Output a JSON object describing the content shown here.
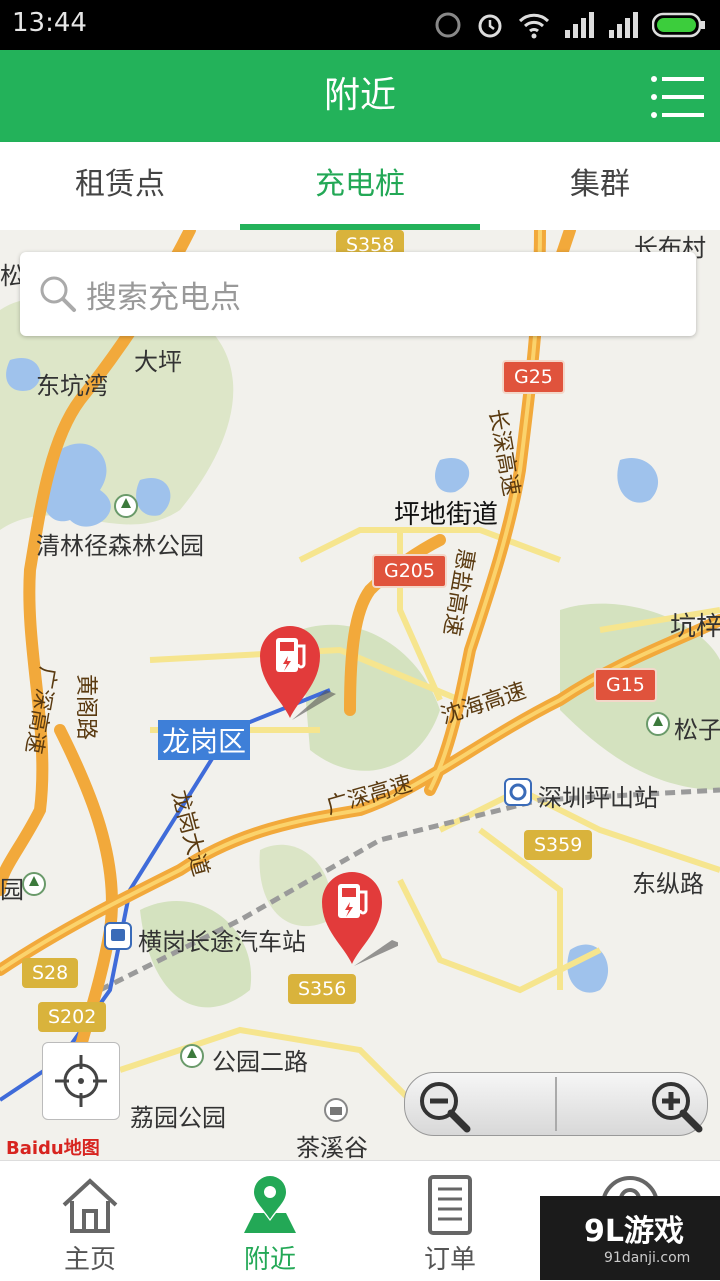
{
  "status_bar": {
    "time": "13:44"
  },
  "header": {
    "title": "附近"
  },
  "tabs": [
    {
      "label": "租赁点",
      "active": false
    },
    {
      "label": "充电桩",
      "active": true
    },
    {
      "label": "集群",
      "active": false
    }
  ],
  "search": {
    "placeholder": "搜索充电点"
  },
  "map": {
    "place_labels": {
      "changbucun": "长布村",
      "song": "松",
      "daping": "大坪",
      "dongkengwan": "东坑湾",
      "qinglinjing": "清林径森林公园",
      "pingdi": "坪地街道",
      "kengzi": "坑梓",
      "songzi": "松子",
      "longgang": "龙岗区",
      "shenzhen_pingshan": "深圳坪山站",
      "dongzonglu": "东纵路",
      "henggang": "横岗长途汽车站",
      "gongyuan": "公园二路",
      "liyuan": "荔园公园",
      "chaxigu": "茶溪谷",
      "yuan_left": "园"
    },
    "road_labels": {
      "changshen": "长深高速",
      "huiyan": "惠盐高速",
      "yanhai": "沈海高速",
      "guangshen": "广深高速",
      "guangshen_left": "广深高速",
      "huangge": "黄阁路",
      "longgang_ave": "龙岗大道"
    },
    "shields": {
      "s358": "S358",
      "g25": "G25",
      "g205": "G205",
      "g15": "G15",
      "s359": "S359",
      "s356": "S356",
      "s28": "S28",
      "s202": "S202"
    },
    "logo": "Baidu地图"
  },
  "bottom_nav": [
    {
      "label": "主页",
      "icon": "home-icon",
      "active": false
    },
    {
      "label": "附近",
      "icon": "location-pin-icon",
      "active": true
    },
    {
      "label": "订单",
      "icon": "order-document-icon",
      "active": false
    },
    {
      "label": "",
      "icon": "user-profile-icon",
      "active": false
    }
  ],
  "watermark": {
    "main": "9L游戏",
    "sub": "91danji.com"
  },
  "colors": {
    "primary": "#23b25a",
    "marker": "#e23b3b",
    "highway": "#f2a93b"
  }
}
